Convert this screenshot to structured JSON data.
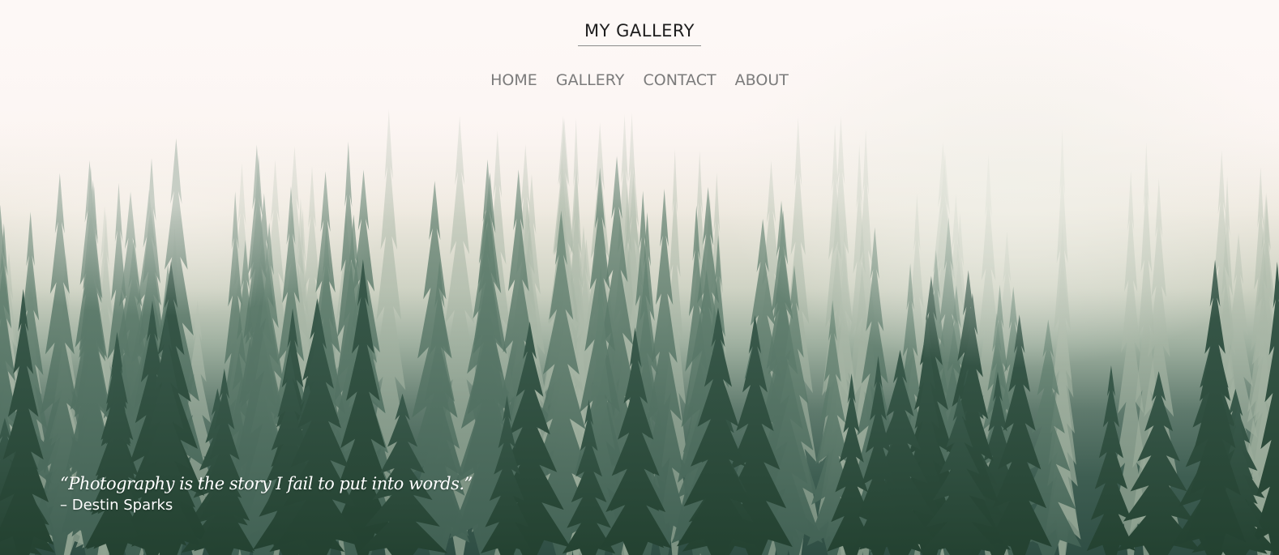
{
  "site": {
    "title": "MY GALLERY"
  },
  "nav": {
    "items": [
      "HOME",
      "GALLERY",
      "CONTACT",
      "ABOUT"
    ]
  },
  "hero": {
    "background_image": "misty-pine-forest",
    "quote_text": "“Photography is the story I fail to put into words.”",
    "quote_author": "– Destin Sparks"
  },
  "colors": {
    "title": "#1d1d1d",
    "nav": "#7b7b7b",
    "quote": "#ffffff"
  }
}
